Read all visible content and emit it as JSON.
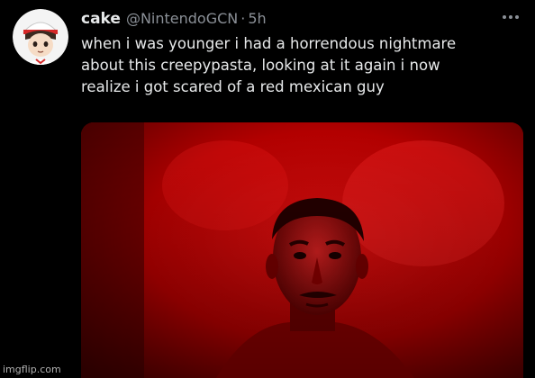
{
  "tweet": {
    "display_name": "cake",
    "handle": "@NintendoGCN",
    "separator": "·",
    "time": "5h",
    "text_lines": [
      "when i was younger i had a horrendous nightmare",
      "about this creepypasta, looking at it again i now",
      "realize i got scared of a red mexican guy"
    ]
  },
  "icons": {
    "more": "more-options-icon",
    "avatar": "profile-avatar"
  },
  "watermark": "imgflip.com",
  "colors": {
    "background": "#000000",
    "text_primary": "#e7e9ea",
    "text_secondary": "#8b9097",
    "image_tint": "#c00000"
  }
}
